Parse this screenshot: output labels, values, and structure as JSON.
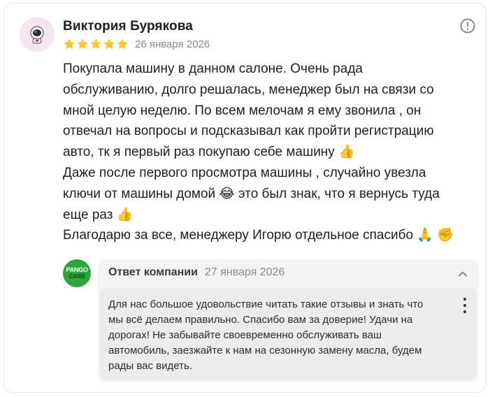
{
  "review": {
    "author": {
      "name": "Виктория Бурякова",
      "avatar_icon": "astronaut-avatar-icon"
    },
    "rating": 5,
    "rating_max": 5,
    "date": "26 января 2026",
    "text": "Покупала машину в данном салоне. Очень рада\nобслуживанию, долго решалась, менеджер был на связи со\nмной целую неделю. По всем мелочам я ему звонила , он\nотвечал на вопросы и подсказывал как пройти регистрацию\nавто, тк я первый раз покупаю себе машину 👍\nДаже после первого просмотра машины , случайно увезла\nключи от машины домой 😂 это был знак, что я вернусь туда\nеще раз 👍\nБлагодарю за все, менеджеру Игорю отдельное спасибо 🙏 ✊",
    "report_icon": "exclamation-circle-icon"
  },
  "reply": {
    "company_logo": {
      "line1": "PANGO",
      "line2": "CARS"
    },
    "title": "Ответ компании",
    "date": "27 января 2026",
    "collapse_icon": "chevron-up-icon",
    "text": "Для нас большое удовольствие читать такие отзывы и знать что\nмы всё делаем правильно. Спасибо вам за доверие! Удачи на\nдорогах! Не забывайте своевременно обслуживать ваш\nавтомобиль, заезжайте к нам на сезонную замену масла, будем\nрады вас видеть.",
    "more_icon": "more-vertical-icon"
  },
  "colors": {
    "star": "#ffc629",
    "logo_bg": "#2aa63b",
    "reply_bg": "#f4f4f4",
    "reply_body_bg": "#ececec",
    "muted_text": "#8a8a8a"
  }
}
